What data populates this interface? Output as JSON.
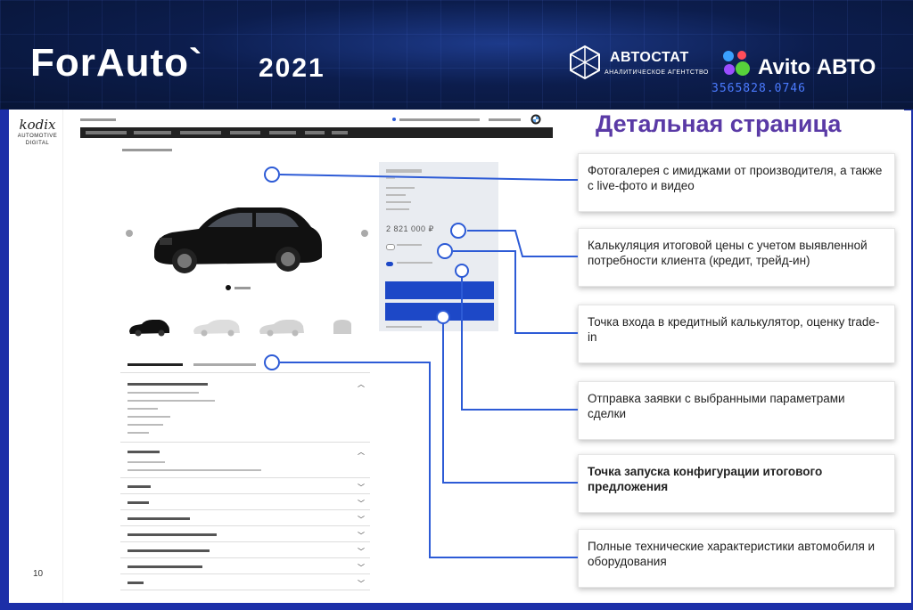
{
  "header": {
    "brand": "ForAuto`",
    "year": "2021",
    "partner1_name": "АВТОСТАТ",
    "partner1_sub": "АНАЛИТИЧЕСКОЕ АГЕНТСТВО",
    "partner2_name": "Avito АВТО",
    "counter": "3565828.0746"
  },
  "slide": {
    "logo_word": "kodix",
    "logo_sub": "AUTOMOTIVE DIGITAL",
    "page_number": "10",
    "title": "Детальная страница",
    "price": "2 821 000 ₽"
  },
  "callouts": [
    {
      "text": "Фотогалерея с имиджами от производителя, а также с live-фото и видео",
      "bold": false
    },
    {
      "text": "Калькуляция итоговой цены с учетом выявленной потребности клиента (кредит, трейд-ин)",
      "bold": false
    },
    {
      "text": "Точка входа в кредитный калькулятор, оценку trade-in",
      "bold": false
    },
    {
      "text": "Отправка заявки с выбранными параметрами сделки",
      "bold": false
    },
    {
      "text": "Точка запуска конфигурации итогового предложения",
      "bold": true
    },
    {
      "text": "Полные технические характеристики автомобиля и оборудования",
      "bold": false
    }
  ],
  "colors": {
    "accent_title": "#5a3aa6",
    "connector": "#2d5bd6",
    "button": "#1d48c7",
    "frame": "#1c2fa8"
  },
  "icons": [
    "avtostat-logo-icon",
    "avito-logo-icon",
    "kodix-logo-icon",
    "bmw-logo-icon",
    "chevron-down-icon",
    "chevron-up-icon"
  ]
}
